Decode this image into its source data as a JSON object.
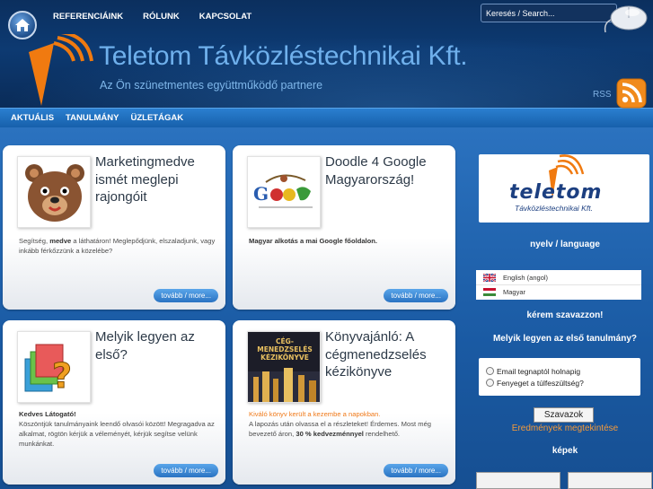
{
  "header": {
    "nav": [
      "REFERENCIÁINK",
      "RÓLUNK",
      "KAPCSOLAT"
    ],
    "search_placeholder": "Keresés / Search...",
    "title": "Teletom Távközléstechnikai Kft.",
    "subtitle": "Az Ön szünetmentes együttműködő partnere",
    "rss": "RSS"
  },
  "subnav": [
    "AKTUÁLIS",
    "TANULMÁNY",
    "ÜZLETÁGAK"
  ],
  "cards": [
    {
      "title": "Marketingmedve ismét meglepi rajongóit",
      "body_pre": "Segítség, ",
      "body_bold": "medve",
      "body_post": " a láthatáron! Meglepődjünk, elszaladjunk, vagy inkább férkőzzünk a közelébe?",
      "more": "tovább / more..."
    },
    {
      "title": "Doodle 4 Google Magyarország!",
      "body": "Magyar alkotás a mai Google főoldalon.",
      "more": "tovább / more..."
    },
    {
      "title": "Melyik legyen az első?",
      "body_heading": "Kedves Látogató!",
      "body": "Köszöntjük tanulmányaink leendő olvasói között! Megragadva az alkalmat, rögtön kérjük a véleményét, kérjük segítse velünk munkánkat.",
      "more": "tovább / more..."
    },
    {
      "title": "Könyvajánló: A cégmenedzselés kézikönyve",
      "body_orange": "Kiváló könyv került a kezembe a napokban.",
      "body": "A lapozás után olvassa el a részleteket! Érdemes. Most még bevezető áron, ",
      "body_bold": "30 % kedvezménnyel",
      "body_post": " rendelhető.",
      "book_cover": "CÉG-MENEDZSELÉS KÉZIKÖNYVE",
      "more": "tovább / more..."
    }
  ],
  "sidebar": {
    "logo_text": "teletom",
    "logo_sub": "Távközléstechnikai Kft.",
    "language_heading": "nyelv / language",
    "languages": [
      {
        "label": "English (angol)",
        "flag": "uk"
      },
      {
        "label": "Magyar",
        "flag": "hu"
      }
    ],
    "poll_heading": "kérem szavazzon!",
    "poll_question": "Melyik legyen az első tanulmány?",
    "poll_options": [
      "Email tegnaptól holnapig",
      "Fenyeget a túlfeszültség?"
    ],
    "vote_button": "Szavazok",
    "results_link": "Eredmények megtekintése",
    "images_heading": "képek"
  },
  "colors": {
    "header_bg": "#0d3a72",
    "title": "#6fb0ec",
    "accent_orange": "#f59a3a",
    "card_bg": "#ffffff"
  }
}
